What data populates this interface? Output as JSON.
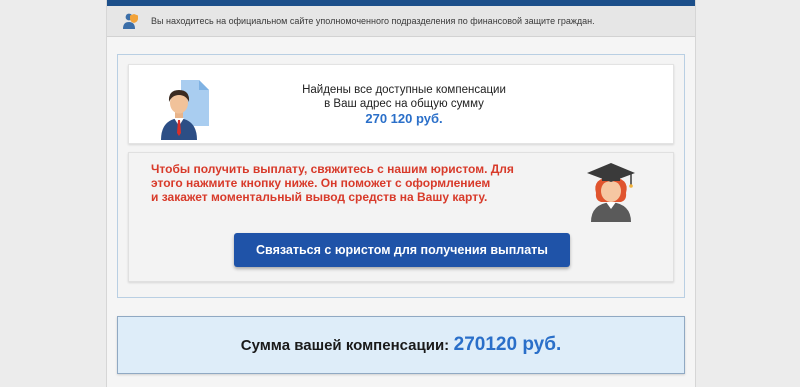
{
  "notice": {
    "text": "Вы находитесь на официальном сайте уполномоченного подразделения по финансовой защите граждан."
  },
  "summary_card": {
    "line1": "Найдены все доступные компенсации",
    "line2": "в Ваш адрес на общую сумму",
    "amount": "270 120 руб."
  },
  "lawyer_card": {
    "line1": "Чтобы получить выплату, свяжитесь с нашим юристом. Для",
    "line2": "этого нажмите кнопку ниже. Он поможет с оформлением",
    "line3": "и закажет моментальный вывод средств на Вашу карту.",
    "button_label": "Связаться с юристом для получения выплаты"
  },
  "total": {
    "label": "Сумма вашей компенсации:",
    "amount": "270120 руб."
  },
  "colors": {
    "header_blue": "#1c4f8a",
    "accent_blue": "#2a6fc9",
    "button_blue": "#1f53a8",
    "warning_red": "#d83a2a",
    "total_bg": "#deedf9"
  },
  "icons": {
    "notice": "user-shield-icon",
    "summary": "person-with-document-icon",
    "lawyer": "graduate-icon"
  }
}
